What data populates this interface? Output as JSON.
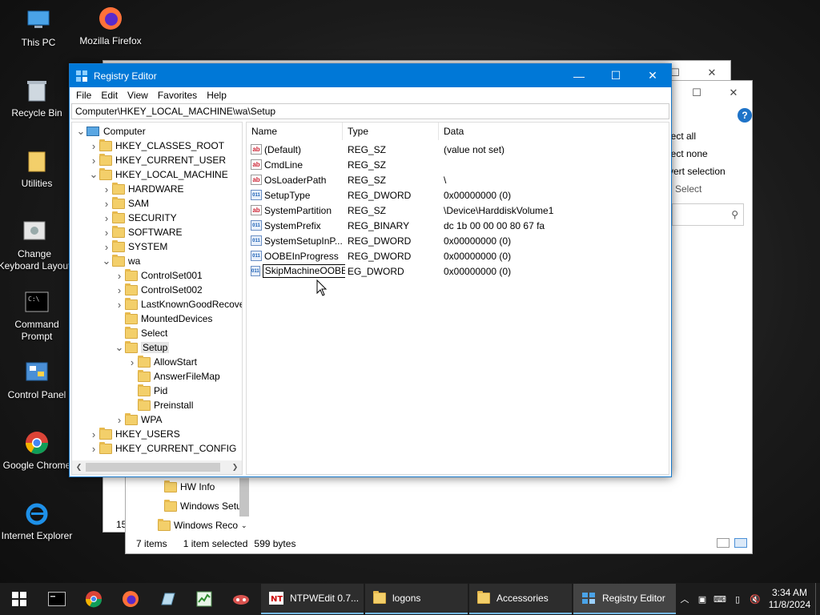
{
  "desktop": {
    "icons": [
      {
        "label": "This PC"
      },
      {
        "label": "Mozilla Firefox"
      },
      {
        "label": "Recycle Bin"
      },
      {
        "label": "Utilities"
      },
      {
        "label": "Change Keyboard Layout"
      },
      {
        "label": "Command Prompt"
      },
      {
        "label": "Control Panel"
      },
      {
        "label": "Google Chrome"
      },
      {
        "label": "Internet Explorer"
      }
    ]
  },
  "bg_explorer": {
    "ribbon": [
      "lect all",
      "lect none",
      "vert selection",
      "Select"
    ],
    "nav_items": [
      "HW Info",
      "Windows Setu",
      "Windows Reco"
    ],
    "left_fragment": "15",
    "status": {
      "items": "7 items",
      "selected": "1 item selected",
      "size": "599 bytes"
    }
  },
  "regedit": {
    "title": "Registry Editor",
    "menu": [
      "File",
      "Edit",
      "View",
      "Favorites",
      "Help"
    ],
    "address": "Computer\\HKEY_LOCAL_MACHINE\\wa\\Setup",
    "tree": [
      {
        "label": "Computer",
        "level": 0,
        "exp": "v",
        "type": "computer"
      },
      {
        "label": "HKEY_CLASSES_ROOT",
        "level": 1,
        "exp": ">"
      },
      {
        "label": "HKEY_CURRENT_USER",
        "level": 1,
        "exp": ">"
      },
      {
        "label": "HKEY_LOCAL_MACHINE",
        "level": 1,
        "exp": "v"
      },
      {
        "label": "HARDWARE",
        "level": 2,
        "exp": ">"
      },
      {
        "label": "SAM",
        "level": 2,
        "exp": ">"
      },
      {
        "label": "SECURITY",
        "level": 2,
        "exp": ">"
      },
      {
        "label": "SOFTWARE",
        "level": 2,
        "exp": ">"
      },
      {
        "label": "SYSTEM",
        "level": 2,
        "exp": ">"
      },
      {
        "label": "wa",
        "level": 2,
        "exp": "v"
      },
      {
        "label": "ControlSet001",
        "level": 3,
        "exp": ">"
      },
      {
        "label": "ControlSet002",
        "level": 3,
        "exp": ">"
      },
      {
        "label": "LastKnownGoodRecove",
        "level": 3,
        "exp": ">"
      },
      {
        "label": "MountedDevices",
        "level": 3,
        "exp": ""
      },
      {
        "label": "Select",
        "level": 3,
        "exp": ""
      },
      {
        "label": "Setup",
        "level": 3,
        "exp": "v",
        "selected": true
      },
      {
        "label": "AllowStart",
        "level": 4,
        "exp": ">"
      },
      {
        "label": "AnswerFileMap",
        "level": 4,
        "exp": ""
      },
      {
        "label": "Pid",
        "level": 4,
        "exp": ""
      },
      {
        "label": "Preinstall",
        "level": 4,
        "exp": ""
      },
      {
        "label": "WPA",
        "level": 3,
        "exp": ">"
      },
      {
        "label": "HKEY_USERS",
        "level": 1,
        "exp": ">"
      },
      {
        "label": "HKEY_CURRENT_CONFIG",
        "level": 1,
        "exp": ">"
      }
    ],
    "columns": [
      "Name",
      "Type",
      "Data"
    ],
    "values": [
      {
        "icon": "ab",
        "name": "(Default)",
        "type": "REG_SZ",
        "data": "(value not set)"
      },
      {
        "icon": "ab",
        "name": "CmdLine",
        "type": "REG_SZ",
        "data": ""
      },
      {
        "icon": "ab",
        "name": "OsLoaderPath",
        "type": "REG_SZ",
        "data": "\\"
      },
      {
        "icon": "bin",
        "name": "SetupType",
        "type": "REG_DWORD",
        "data": "0x00000000 (0)"
      },
      {
        "icon": "ab",
        "name": "SystemPartition",
        "type": "REG_SZ",
        "data": "\\Device\\HarddiskVolume1"
      },
      {
        "icon": "bin",
        "name": "SystemPrefix",
        "type": "REG_BINARY",
        "data": "dc 1b 00 00 00 80 67 fa"
      },
      {
        "icon": "bin",
        "name": "SystemSetupInP...",
        "type": "REG_DWORD",
        "data": "0x00000000 (0)"
      },
      {
        "icon": "bin",
        "name": "OOBEInProgress",
        "type": "REG_DWORD",
        "data": "0x00000000 (0)"
      },
      {
        "icon": "bin",
        "name": "SkipMachineOOBE",
        "type": "EG_DWORD",
        "data": "0x00000000 (0)",
        "renaming": true
      }
    ]
  },
  "taskbar": {
    "tasks": [
      {
        "label": "NTPWEdit 0.7..."
      },
      {
        "label": "logons"
      },
      {
        "label": "Accessories"
      },
      {
        "label": "Registry Editor"
      }
    ],
    "clock": {
      "time": "3:34 AM",
      "date": "11/8/2024"
    }
  },
  "colors": {
    "accent": "#0078d7",
    "taskbar": "#1c1c1c",
    "folder": "#f3cf6a"
  }
}
